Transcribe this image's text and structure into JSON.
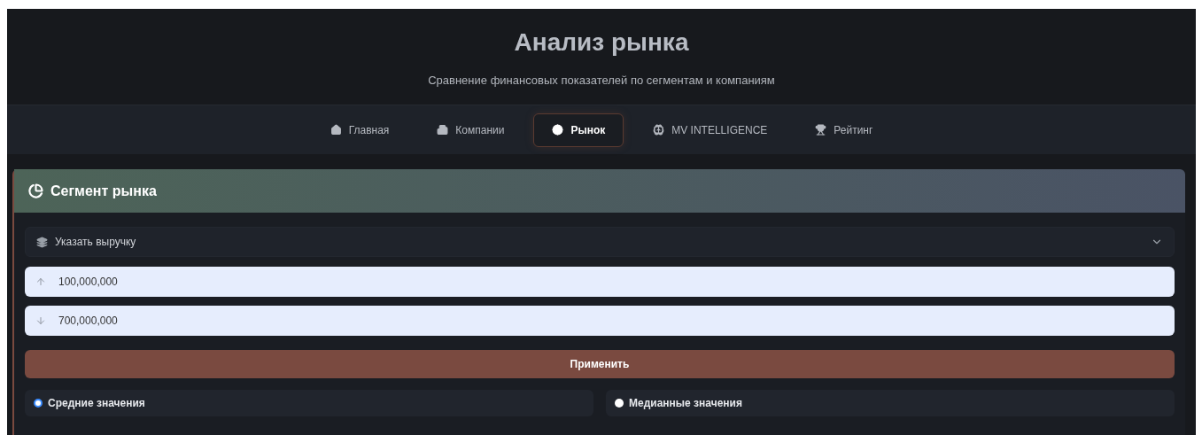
{
  "header": {
    "title": "Анализ рынка",
    "subtitle": "Сравнение финансовых показателей по сегментам и компаниям"
  },
  "nav": [
    {
      "label": "Главная",
      "selected": false
    },
    {
      "label": "Компании",
      "selected": false
    },
    {
      "label": "Рынок",
      "selected": true
    },
    {
      "label": "MV INTELLIGENCE",
      "selected": false
    },
    {
      "label": "Рейтинг",
      "selected": false
    }
  ],
  "card": {
    "title": "Сегмент рынка",
    "select": {
      "value": "Указать выручку"
    },
    "min_field": {
      "value": "100,000,000"
    },
    "max_field": {
      "value": "700,000,000"
    },
    "apply_button": "Применить",
    "modes": [
      {
        "label": "Средние значения",
        "selected": true
      },
      {
        "label": "Медианные значения",
        "selected": false
      }
    ]
  }
}
